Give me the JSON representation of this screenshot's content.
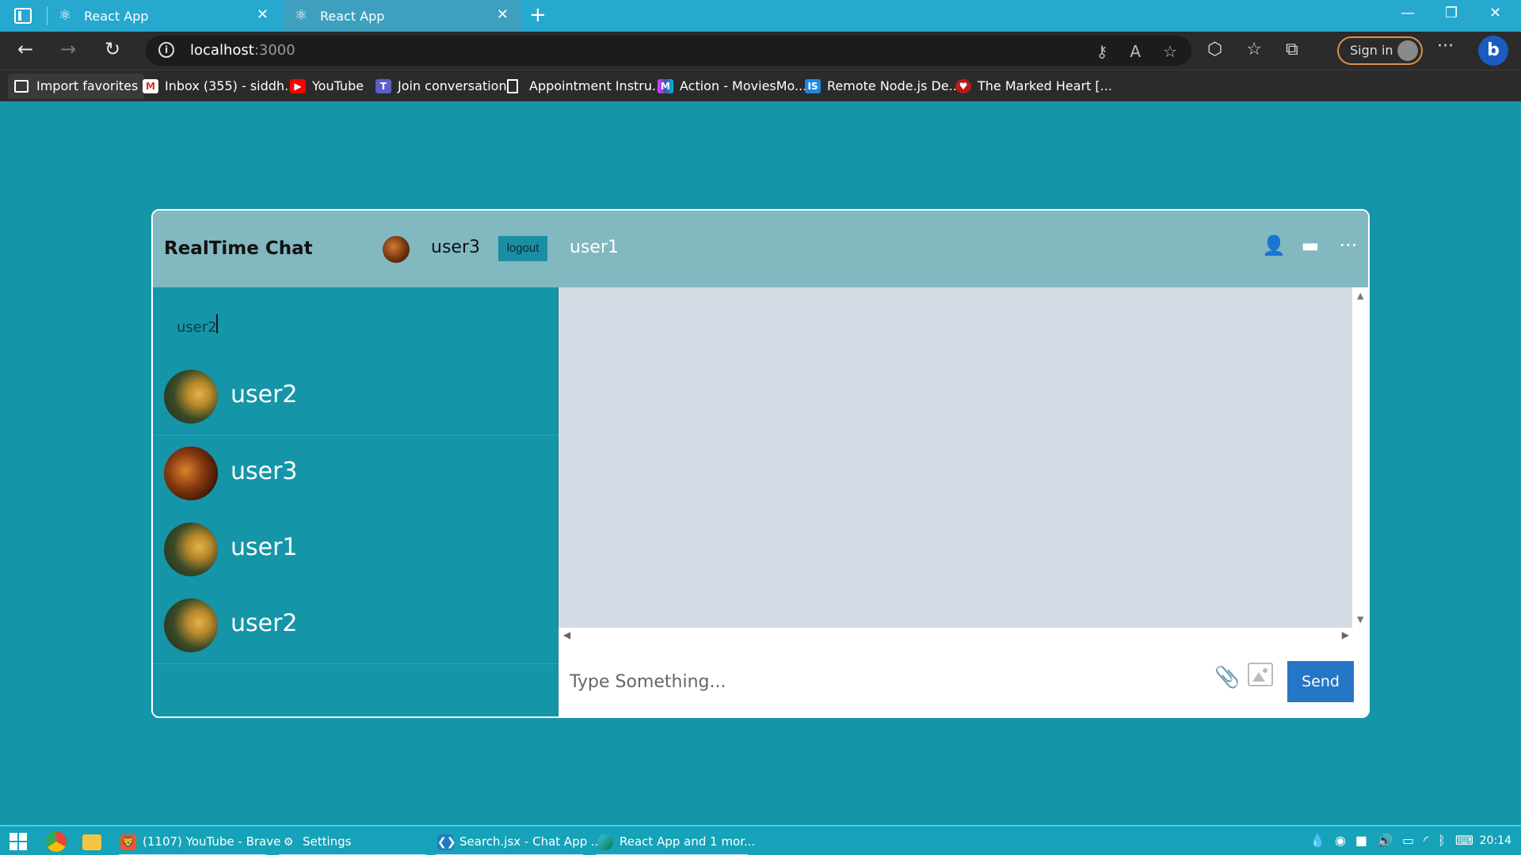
{
  "browser": {
    "tabs": [
      {
        "label": "React App"
      },
      {
        "label": "React App"
      }
    ],
    "url_host": "localhost",
    "url_port": ":3000",
    "signin_label": "Sign in",
    "favorites": [
      {
        "label": "Import favorites"
      },
      {
        "label": "Inbox (355) - siddh..."
      },
      {
        "label": "YouTube"
      },
      {
        "label": "Join conversation"
      },
      {
        "label": "Appointment Instru..."
      },
      {
        "label": "Action - MoviesMo..."
      },
      {
        "label": "Remote Node.js De..."
      },
      {
        "label": "The Marked Heart [..."
      }
    ]
  },
  "app": {
    "brand": "RealTime Chat",
    "current_user": "user3",
    "logout_label": "logout",
    "search_value": "user2",
    "search_results": [
      {
        "name": "user2"
      }
    ],
    "chats": [
      {
        "name": "user3"
      },
      {
        "name": "user1"
      },
      {
        "name": "user2"
      }
    ],
    "active_chat": "user1",
    "message_placeholder": "Type Something...",
    "send_label": "Send"
  },
  "taskbar": {
    "items": [
      {
        "label": "(1107) YouTube - Brave"
      },
      {
        "label": "Settings"
      },
      {
        "label": "Search.jsx - Chat App ..."
      },
      {
        "label": "React App and 1 mor..."
      }
    ],
    "time": "20:14"
  },
  "colors": {
    "page_bg": "#1595a8",
    "header_bg": "#82b8c0",
    "messages_bg": "#d4dbe4",
    "send_btn": "#2676c8"
  }
}
